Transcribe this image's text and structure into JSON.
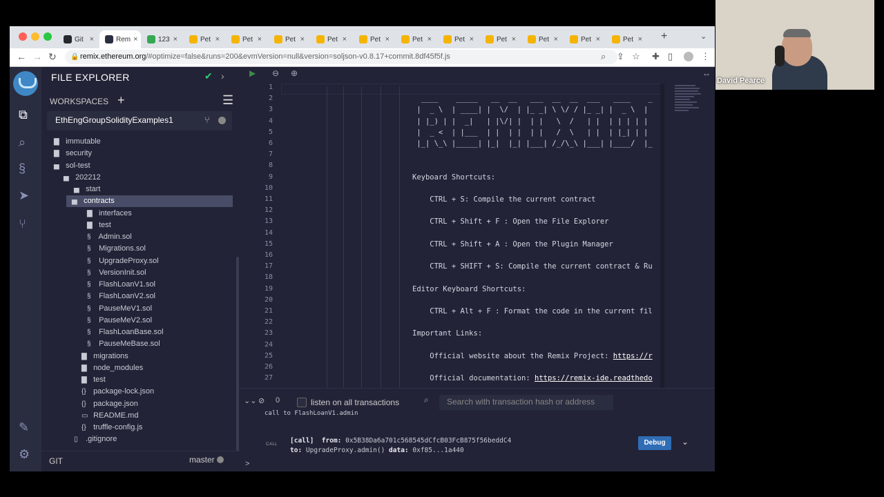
{
  "browser": {
    "tabs": [
      {
        "label": "Git",
        "color": "#24292e"
      },
      {
        "label": "Rem",
        "color": "#2b2d42"
      },
      {
        "label": "123",
        "color": "#34a853"
      },
      {
        "label": "Pet",
        "color": "#f4b400"
      },
      {
        "label": "Pet",
        "color": "#f4b400"
      },
      {
        "label": "Pet",
        "color": "#f4b400"
      },
      {
        "label": "Pet",
        "color": "#f4b400"
      },
      {
        "label": "Pet",
        "color": "#f4b400"
      },
      {
        "label": "Pet",
        "color": "#f4b400"
      },
      {
        "label": "Pet",
        "color": "#f4b400"
      },
      {
        "label": "Pet",
        "color": "#f4b400"
      },
      {
        "label": "Pet",
        "color": "#f4b400"
      },
      {
        "label": "Pet",
        "color": "#f4b400"
      },
      {
        "label": "Pet",
        "color": "#f4b400"
      }
    ],
    "url_host": "remix.ethereum.org",
    "url_rest": "/#optimize=false&runs=200&evmVersion=null&version=soljson-v0.8.17+commit.8df45f5f.js"
  },
  "sidebar": {
    "title": "FILE EXPLORER",
    "workspaces_label": "WORKSPACES",
    "workspace_name": "EthEngGroupSolidityExamples1",
    "git_label": "GIT",
    "branch": "master"
  },
  "tree": [
    {
      "label": "immutable",
      "type": "folder",
      "depth": 0
    },
    {
      "label": "security",
      "type": "folder",
      "depth": 0
    },
    {
      "label": "sol-test",
      "type": "folder-open",
      "depth": 0
    },
    {
      "label": "202212",
      "type": "folder-open",
      "depth": 1
    },
    {
      "label": "start",
      "type": "folder-open",
      "depth": 2
    },
    {
      "label": "contracts",
      "type": "folder-open",
      "depth": 3,
      "selected": true
    },
    {
      "label": "interfaces",
      "type": "folder",
      "depth": 4
    },
    {
      "label": "test",
      "type": "folder",
      "depth": 4
    },
    {
      "label": "Admin.sol",
      "type": "sol",
      "depth": 4
    },
    {
      "label": "Migrations.sol",
      "type": "sol",
      "depth": 4
    },
    {
      "label": "UpgradeProxy.sol",
      "type": "sol",
      "depth": 4
    },
    {
      "label": "VersionInit.sol",
      "type": "sol",
      "depth": 4
    },
    {
      "label": "FlashLoanV1.sol",
      "type": "sol",
      "depth": 4
    },
    {
      "label": "FlashLoanV2.sol",
      "type": "sol",
      "depth": 4
    },
    {
      "label": "PauseMeV1.sol",
      "type": "sol",
      "depth": 4
    },
    {
      "label": "PauseMeV2.sol",
      "type": "sol",
      "depth": 4
    },
    {
      "label": "FlashLoanBase.sol",
      "type": "sol",
      "depth": 4
    },
    {
      "label": "PauseMeBase.sol",
      "type": "sol",
      "depth": 4
    },
    {
      "label": "migrations",
      "type": "folder",
      "depth": 3
    },
    {
      "label": "node_modules",
      "type": "folder",
      "depth": 3
    },
    {
      "label": "test",
      "type": "folder",
      "depth": 3
    },
    {
      "label": "package-lock.json",
      "type": "json",
      "depth": 3
    },
    {
      "label": "package.json",
      "type": "json",
      "depth": 3
    },
    {
      "label": "README.md",
      "type": "md",
      "depth": 3
    },
    {
      "label": "truffle-config.js",
      "type": "js",
      "depth": 3
    },
    {
      "label": ".gitignore",
      "type": "file",
      "depth": 2
    }
  ],
  "editor": {
    "line_numbers": [
      "1",
      "2",
      "3",
      "4",
      "5",
      "6",
      "7",
      "8",
      "9",
      "10",
      "11",
      "12",
      "13",
      "14",
      "15",
      "16",
      "17",
      "18",
      "19",
      "20",
      "21",
      "22",
      "23",
      "24",
      "25",
      "26",
      "27"
    ],
    "lines": [
      "",
      "                              ____    _____   __  __   ___  __  __  ___   ____    _",
      "                             |  _ \\  | ____| |  \\/  | |_ _| \\ \\/ / |_ _| |  _ \\  |",
      "                             | |_) | |  _|   | |\\/| |  | |   \\  /   | |  | | | | |",
      "                             |  _ <  | |___  | |  | |  | |   /  \\   | |  | |_| | |",
      "                             |_| \\_\\ |_____| |_|  |_| |___| /_/\\_\\ |___| |____/  |_",
      "",
      "",
      "                            Keyboard Shortcuts:",
      "",
      "                                CTRL + S: Compile the current contract",
      "",
      "                                CTRL + Shift + F : Open the File Explorer",
      "",
      "                                CTRL + Shift + A : Open the Plugin Manager",
      "",
      "                                CTRL + SHIFT + S: Compile the current contract & Ru",
      "",
      "                            Editor Keyboard Shortcuts:",
      "",
      "                                CTRL + Alt + F : Format the code in the current fil",
      "",
      "                            Important Links:",
      "",
      "                                Official website about the Remix Project: ",
      "",
      "                                Official documentation: "
    ],
    "link_line25": "https://r",
    "link_line27": "https://remix-ide.readthedo"
  },
  "terminal": {
    "count": "0",
    "listen_label": "listen on all transactions",
    "search_placeholder": "Search with transaction hash or address",
    "prev_log": "call to FlashLoanV1.admin",
    "call_tag": "CALL",
    "line1_prefix": "[call]",
    "line1_from_label": "from:",
    "line1_from": "0x5B38Da6a701c568545dCfcB03FcB875f56beddC4",
    "line2_to_label": "to:",
    "line2_to": "UpgradeProxy.admin()",
    "line2_data_label": "data:",
    "line2_data": "0xf85...1a440",
    "debug_label": "Debug",
    "prompt": ">"
  },
  "webcam": {
    "name": "David Pearce"
  }
}
